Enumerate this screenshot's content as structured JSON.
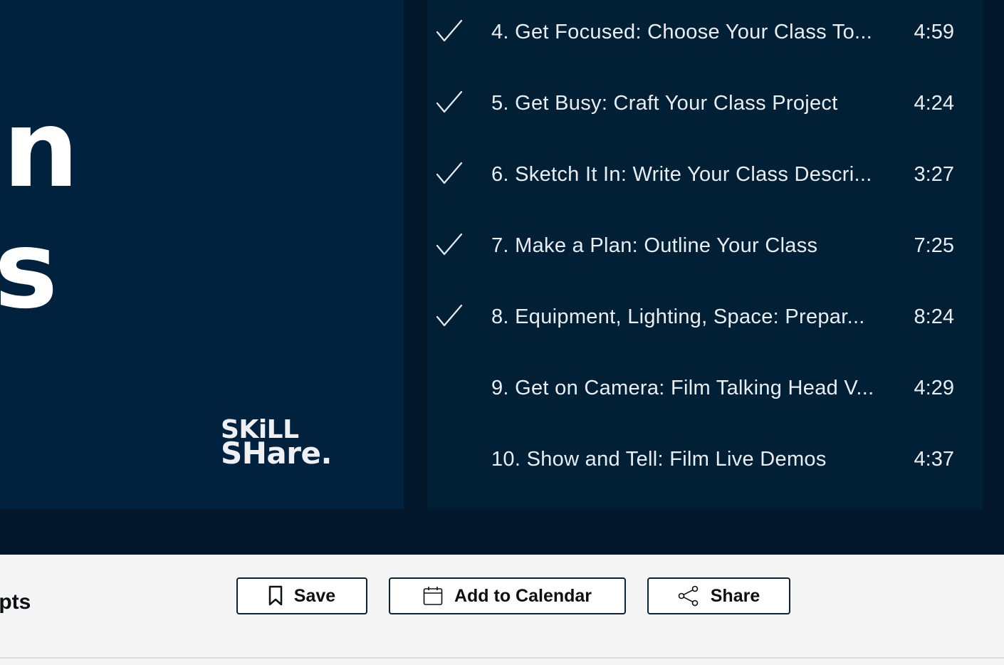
{
  "video": {
    "big_letters": [
      "n",
      "s"
    ],
    "logo": {
      "line1": "SKiLL",
      "line2": "SHare."
    }
  },
  "lessons": [
    {
      "title": "4. Get Focused: Choose Your Class To...",
      "duration": "4:59",
      "completed": true
    },
    {
      "title": "5. Get Busy: Craft Your Class Project",
      "duration": "4:24",
      "completed": true
    },
    {
      "title": "6. Sketch It In: Write Your Class Descri...",
      "duration": "3:27",
      "completed": true
    },
    {
      "title": "7. Make a Plan: Outline Your Class",
      "duration": "7:25",
      "completed": true
    },
    {
      "title": "8. Equipment, Lighting, Space: Prepar...",
      "duration": "8:24",
      "completed": true
    },
    {
      "title": "9. Get on Camera: Film Talking Head V...",
      "duration": "4:29",
      "completed": false
    },
    {
      "title": "10. Show and Tell: Film Live Demos",
      "duration": "4:37",
      "completed": false
    }
  ],
  "toolbar": {
    "tab_partial": "ipts",
    "save_label": "Save",
    "calendar_label": "Add to Calendar",
    "share_label": "Share"
  },
  "icons": {
    "check": "checkmark-icon",
    "save": "bookmark-icon",
    "calendar": "calendar-icon",
    "share": "share-icon"
  },
  "colors": {
    "player_bg": "#03192b",
    "video_bg": "#01223f",
    "text": "#e9eef3",
    "button_border": "#0e2033"
  }
}
